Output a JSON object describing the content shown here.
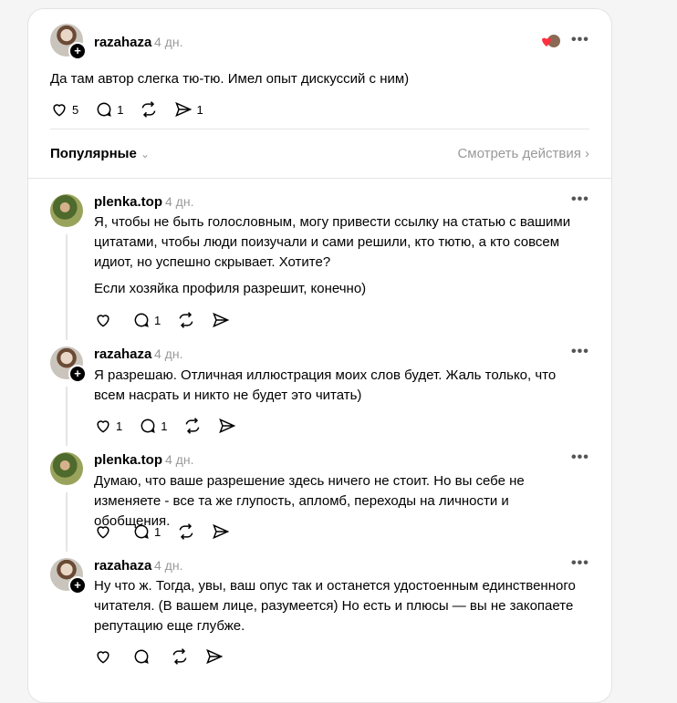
{
  "main_post": {
    "username": "razahaza",
    "time": "4 дн.",
    "text": "Да там автор слегка тю-тю. Имел опыт дискуссий с ним)",
    "likes": "5",
    "replies": "1",
    "shares": "1"
  },
  "sort": {
    "label": "Популярные",
    "activity_link": "Смотреть действия"
  },
  "comments": [
    {
      "username": "plenka.top",
      "time": "4 дн.",
      "paragraphs": [
        "Я, чтобы не быть голословным, могу привести ссылку на статью с вашими цитатами, чтобы люди поизучали и сами решили, кто тютю, а кто совсем идиот, но успешно скрывает. Хотите?",
        "Если хозяйка профиля разрешит, конечно)"
      ],
      "likes": "",
      "replies": "1"
    },
    {
      "username": "razahaza",
      "time": "4 дн.",
      "paragraphs": [
        "Я разрешаю. Отличная иллюстрация моих слов будет. Жаль только, что всем насрать и никто не будет это читать)"
      ],
      "likes": "1",
      "replies": "1"
    },
    {
      "username": "plenka.top",
      "time": "4 дн.",
      "paragraphs": [
        "Думаю, что ваше разрешение здесь ничего не стоит. Но вы себе не изменяете - все та же глупость, апломб, переходы на личности и обобщения."
      ],
      "likes": "",
      "replies": "1"
    },
    {
      "username": "razahaza",
      "time": "4 дн.",
      "paragraphs": [
        "Ну что ж. Тогда, увы, ваш опус так и останется удостоенным единственного читателя. (В вашем лице, разумеется) Но есть и плюсы — вы не закопаете репутацию еще глубже."
      ],
      "likes": "",
      "replies": ""
    }
  ],
  "icons": {
    "like": "heart-icon",
    "reply": "comment-icon",
    "repost": "repost-icon",
    "share": "send-icon",
    "more": "more-icon",
    "follow": "plus-icon"
  },
  "colors": {
    "like_heart": "#ff3040",
    "muted_text": "#999999"
  }
}
